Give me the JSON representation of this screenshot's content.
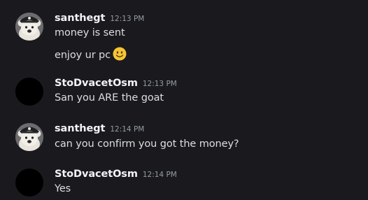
{
  "messages": [
    {
      "username": "santhegt",
      "time": "12:13 PM",
      "avatar": "pirate-bear-avatar",
      "lines": [
        "money is sent",
        "enjoy ur pc"
      ],
      "emoji": "slightly-smiling-face-emoji"
    },
    {
      "username": "StoDvacetOsm",
      "time": "12:13 PM",
      "avatar": "black-avatar",
      "lines": [
        "San you ARE the goat"
      ]
    },
    {
      "username": "santhegt",
      "time": "12:14 PM",
      "avatar": "pirate-bear-avatar",
      "lines": [
        "can you confirm you got the money?"
      ]
    },
    {
      "username": "StoDvacetOsm",
      "time": "12:14 PM",
      "avatar": "black-avatar",
      "lines": [
        "Yes"
      ]
    }
  ],
  "colors": {
    "background": "#1a1a1e",
    "username": "#f2f3f5",
    "timestamp": "#949ba4",
    "message_text": "#dbdee1",
    "emoji_face": "#f6c534"
  }
}
